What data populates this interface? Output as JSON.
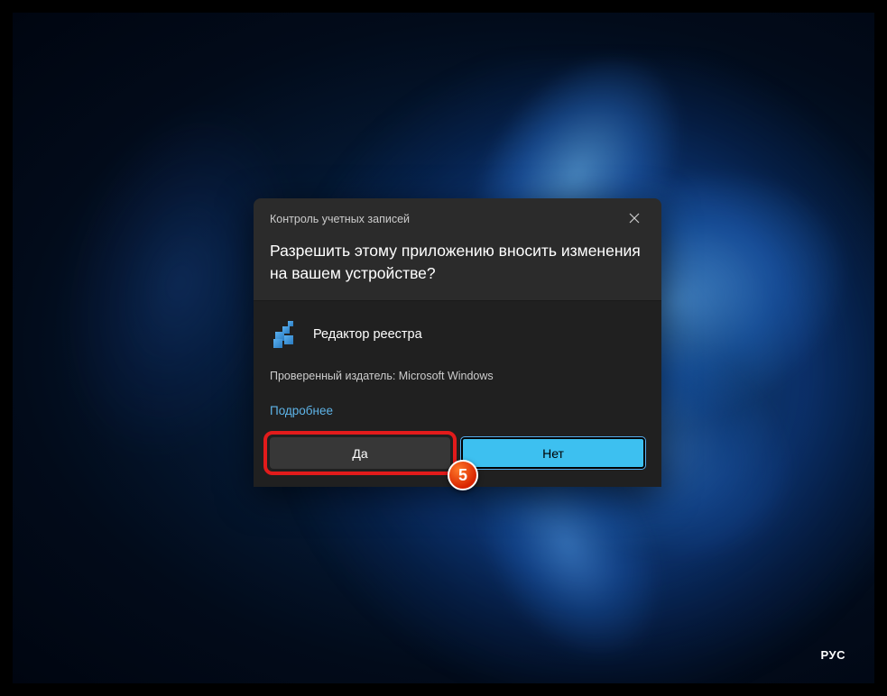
{
  "dialog": {
    "title": "Контроль учетных записей",
    "question": "Разрешить этому приложению вносить изменения на вашем устройстве?",
    "app_name": "Редактор реестра",
    "publisher": "Проверенный издатель: Microsoft Windows",
    "more_link": "Подробнее",
    "yes_label": "Да",
    "no_label": "Нет"
  },
  "annotation": {
    "step_number": "5"
  },
  "taskbar": {
    "language": "РУС"
  }
}
